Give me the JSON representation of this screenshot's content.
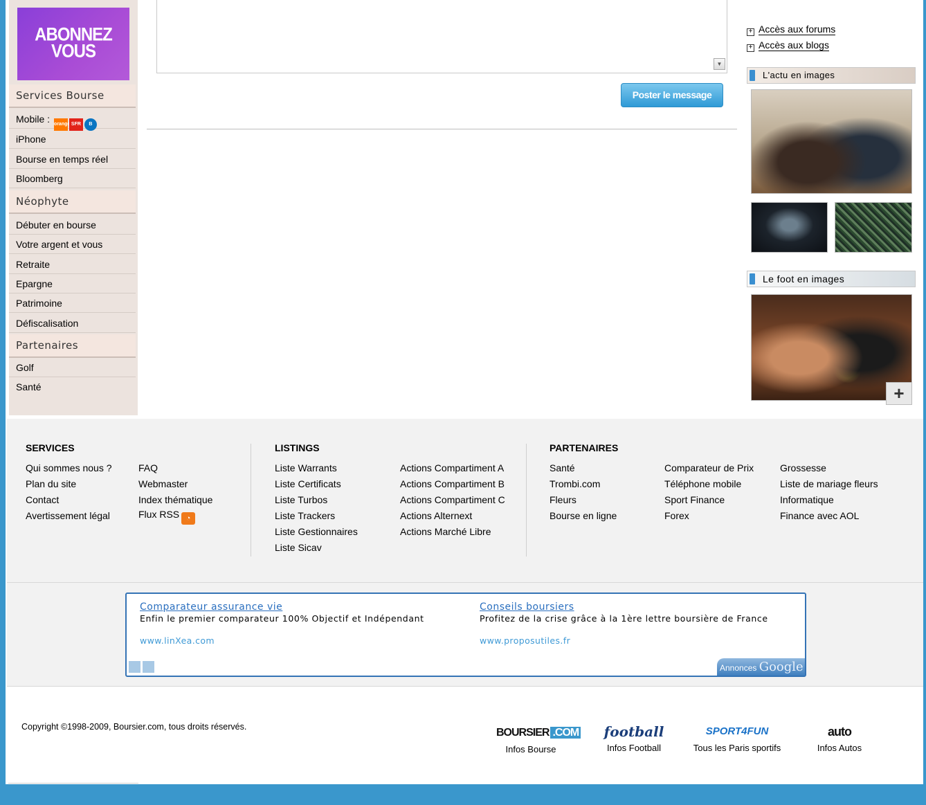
{
  "promo": {
    "line1": "ABONNEZ",
    "line2": "VOUS"
  },
  "sidebar": {
    "services_title": "Services Bourse",
    "mobile_label": "Mobile :",
    "mobile_logos": {
      "orange": "orange",
      "sfr": "SFR",
      "bouygues": "B"
    },
    "services_items": [
      "iPhone",
      "Bourse en temps réel",
      "Bloomberg"
    ],
    "neophyte_title": "Néophyte",
    "neophyte_items": [
      "Débuter en bourse",
      "Votre argent et vous",
      "Retraite",
      "Epargne",
      "Patrimoine",
      "Défiscalisation"
    ],
    "partenaires_title": "Partenaires",
    "partenaires_items": [
      "Golf",
      "Santé"
    ]
  },
  "center": {
    "textarea_value": "",
    "post_button": "Poster le message"
  },
  "right": {
    "links": [
      "Accès aux forums",
      "Accès aux blogs"
    ],
    "actu_title": "L'actu en images",
    "foot_title": "Le foot en images",
    "plus_label": "+"
  },
  "footer": {
    "services": {
      "title": "SERVICES",
      "col1": [
        "Qui sommes nous ?",
        "Plan du site",
        "Contact",
        "Avertissement légal"
      ],
      "col2": [
        "FAQ",
        "Webmaster",
        "Index thématique",
        "Flux RSS"
      ]
    },
    "listings": {
      "title": "LISTINGS",
      "col1": [
        "Liste Warrants",
        "Liste Certificats",
        "Liste Turbos",
        "Liste Trackers",
        "Liste Gestionnaires",
        "Liste Sicav"
      ],
      "col2": [
        "Actions Compartiment A",
        "Actions Compartiment B",
        "Actions Compartiment C",
        "Actions Alternext",
        "Actions Marché Libre"
      ]
    },
    "partenaires": {
      "title": "PARTENAIRES",
      "col1": [
        "Santé",
        "Trombi.com",
        "Fleurs",
        "Bourse en ligne"
      ],
      "col2": [
        "Comparateur de Prix",
        "Téléphone mobile",
        "Sport Finance",
        "Forex"
      ],
      "col3": [
        "Grossesse",
        "Liste de mariage fleurs",
        "Informatique",
        "Finance avec AOL"
      ]
    }
  },
  "ads": [
    {
      "title": "Comparateur assurance vie",
      "text": "Enfin le premier comparateur 100% Objectif et Indépendant",
      "url": "www.linXea.com"
    },
    {
      "title": "Conseils boursiers",
      "text": "Profitez de la crise grâce à la 1ère lettre boursière de France",
      "url": "www.proposutiles.fr"
    }
  ],
  "ads_badge": {
    "prefix": "Annonces",
    "brand": "Google"
  },
  "copyright": "Copyright ©1998-2009, Boursier.com, tous droits réservés.",
  "brands": [
    {
      "logo_a": "BOURSIER",
      "logo_b": ".COM",
      "label": "Infos Bourse"
    },
    {
      "logo": "football",
      "label": "Infos Football"
    },
    {
      "logo": "SPORT4FUN",
      "label": "Tous les Paris sportifs"
    },
    {
      "logo": "auto",
      "label": "Infos Autos"
    }
  ],
  "colors": {
    "frame": "#3a97cc",
    "sidebar_bg": "#ece3de",
    "link_blue": "#2a6fbf"
  }
}
